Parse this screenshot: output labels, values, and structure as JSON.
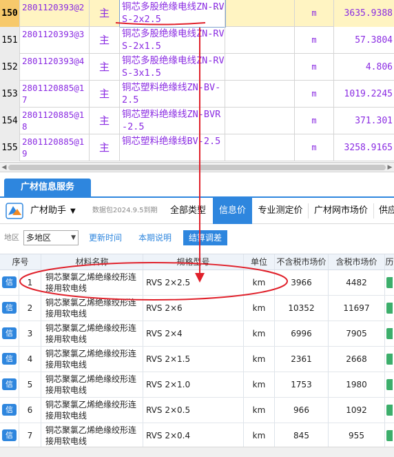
{
  "sheet_rows": [
    {
      "num": "150",
      "code": "2801120393@2",
      "type": "主",
      "name": "铜芯多股绝缘电线ZN-RVS-2x2.5",
      "unit": "m",
      "value": "3635.9388",
      "selected": true
    },
    {
      "num": "151",
      "code": "2801120393@3",
      "type": "主",
      "name": "铜芯多股绝缘电线ZN-RVS-2x1.5",
      "unit": "m",
      "value": "57.3804",
      "selected": false
    },
    {
      "num": "152",
      "code": "2801120393@4",
      "type": "主",
      "name": "铜芯多股绝缘电线ZN-RVS-3x1.5",
      "unit": "m",
      "value": "4.806",
      "selected": false
    },
    {
      "num": "153",
      "code": "2801120885@17",
      "type": "主",
      "name": "铜芯塑料绝缘线ZN-BV-2.5",
      "unit": "m",
      "value": "1019.2245",
      "selected": false
    },
    {
      "num": "154",
      "code": "2801120885@18",
      "type": "主",
      "name": "铜芯塑料绝缘线ZN-BVR-2.5",
      "unit": "m",
      "value": "371.301",
      "selected": false
    },
    {
      "num": "155",
      "code": "2801120885@19",
      "type": "主",
      "name": "铜芯塑料绝缘线BV-2.5",
      "unit": "m",
      "value": "3258.9165",
      "selected": false
    }
  ],
  "more_glyph": "···",
  "panel": {
    "tab_label": "广材信息服务",
    "assistant_label": "广材助手",
    "expiry": "数据包2024.9.5到期",
    "tabs": [
      "全部类型",
      "信息价",
      "专业测定价",
      "广材网市场价",
      "供应"
    ]
  },
  "filter": {
    "area_label": "地区",
    "area_value": "多地区",
    "buttons": [
      "更新时间",
      "本期说明",
      "结算调差"
    ]
  },
  "table": {
    "headers": [
      "序号",
      "材料名称",
      "规格型号",
      "单位",
      "不含税市场价",
      "含税市场价",
      "历"
    ],
    "badge": "信",
    "rows": [
      {
        "idx": "1",
        "name": "铜芯聚氯乙烯绝缘绞形连接用软电线",
        "spec": "RVS 2×2.5",
        "unit": "km",
        "ex": "3966",
        "in": "4482"
      },
      {
        "idx": "2",
        "name": "铜芯聚氯乙烯绝缘绞形连接用软电线",
        "spec": "RVS 2×6",
        "unit": "km",
        "ex": "10352",
        "in": "11697"
      },
      {
        "idx": "3",
        "name": "铜芯聚氯乙烯绝缘绞形连接用软电线",
        "spec": "RVS 2×4",
        "unit": "km",
        "ex": "6996",
        "in": "7905"
      },
      {
        "idx": "4",
        "name": "铜芯聚氯乙烯绝缘绞形连接用软电线",
        "spec": "RVS 2×1.5",
        "unit": "km",
        "ex": "2361",
        "in": "2668"
      },
      {
        "idx": "5",
        "name": "铜芯聚氯乙烯绝缘绞形连接用软电线",
        "spec": "RVS 2×1.0",
        "unit": "km",
        "ex": "1753",
        "in": "1980"
      },
      {
        "idx": "6",
        "name": "铜芯聚氯乙烯绝缘绞形连接用软电线",
        "spec": "RVS 2×0.5",
        "unit": "km",
        "ex": "966",
        "in": "1092"
      },
      {
        "idx": "7",
        "name": "铜芯聚氯乙烯绝缘绞形连接用软电线",
        "spec": "RVS 2×0.4",
        "unit": "km",
        "ex": "845",
        "in": "955"
      }
    ]
  },
  "colors": {
    "accent": "#2e86de",
    "annotation_red": "#e0202a",
    "sheet_text": "#8a2be2",
    "selected_row": "#fff4c2",
    "selected_rownum": "#f7c96b"
  }
}
